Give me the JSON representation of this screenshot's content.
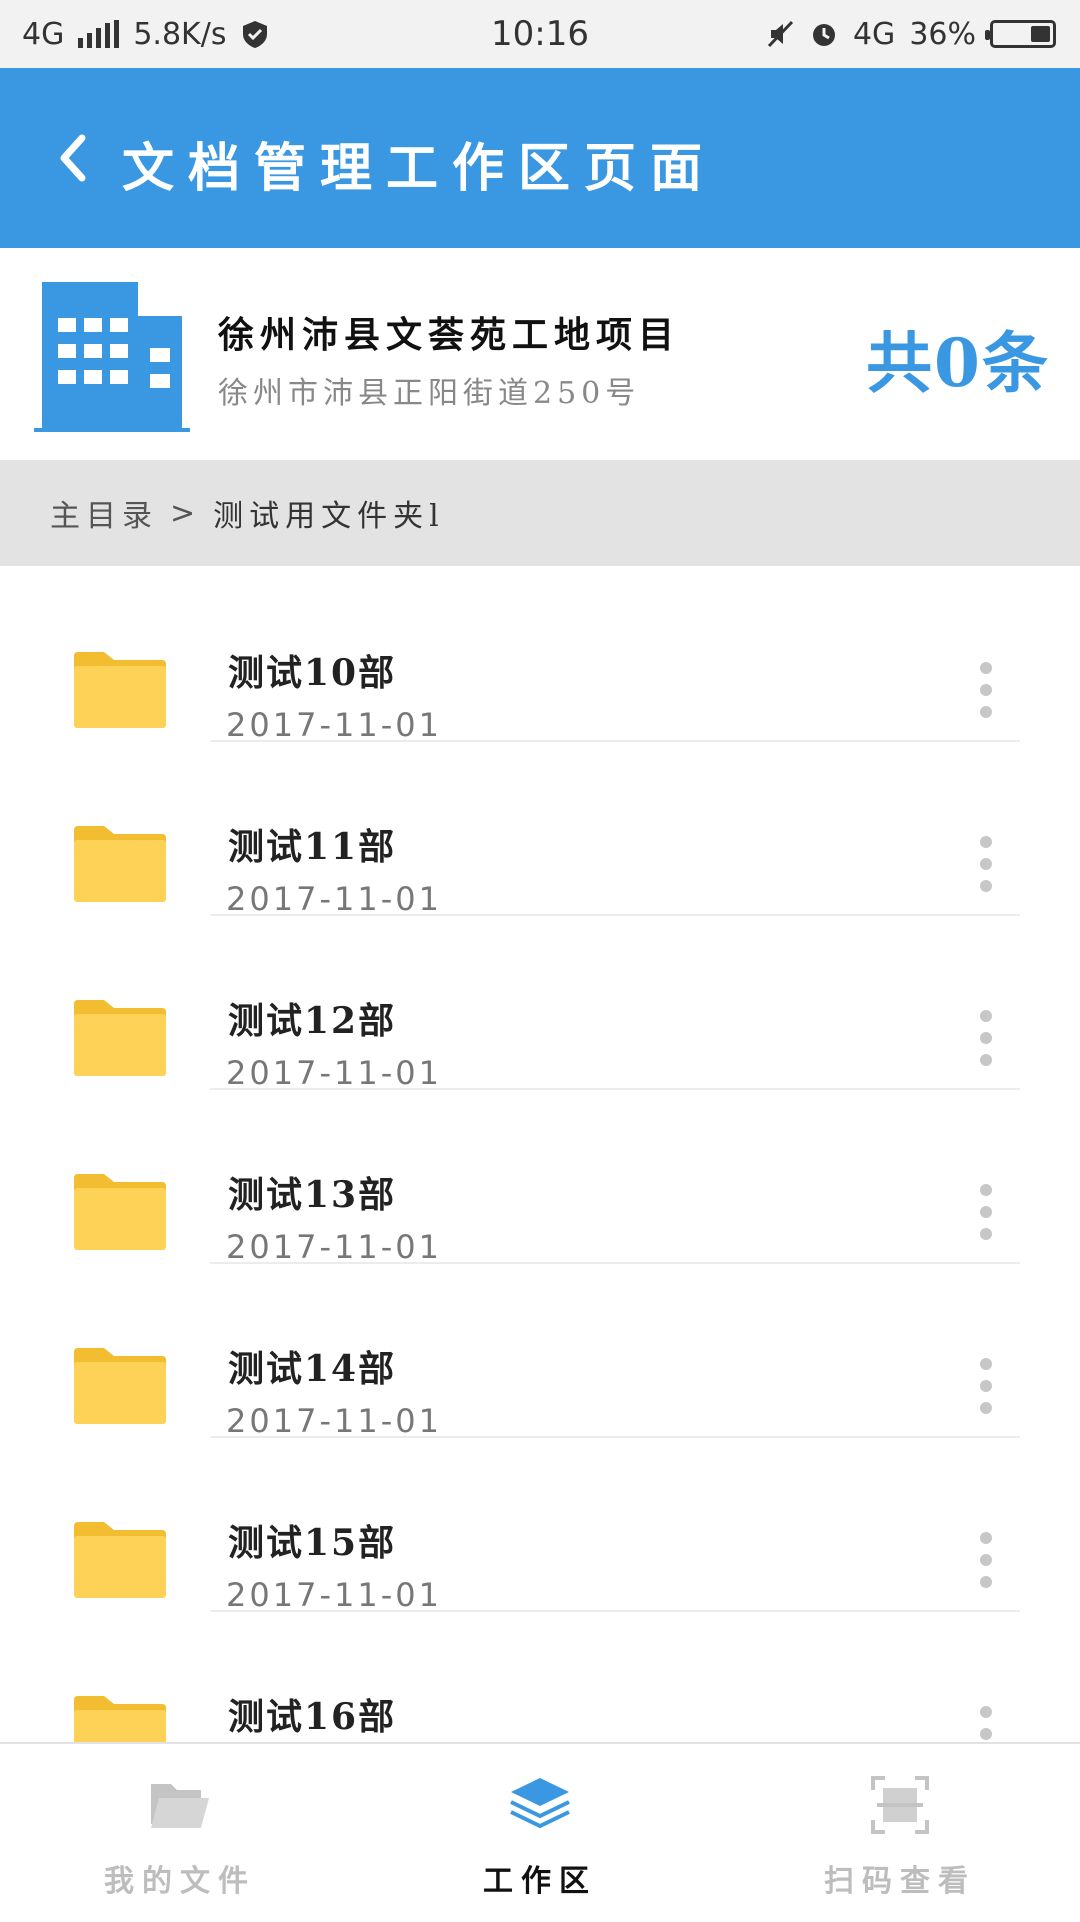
{
  "status_bar": {
    "network": "4G",
    "speed": "5.8K/s",
    "time": "10:16",
    "network_right": "4G",
    "battery": "36%",
    "battery_level": 0.36
  },
  "header": {
    "title": "文档管理工作区页面",
    "background": "#3a98e3"
  },
  "project": {
    "name": "徐州沛县文荟苑工地项目",
    "address": "徐州市沛县正阳街道250号",
    "count": "共0条",
    "accent": "#3a98e3"
  },
  "breadcrumb": {
    "home": "主目录",
    "separator": ">",
    "current": "测试用文件夹l"
  },
  "files": [
    {
      "name": "测试10部",
      "date": "2017-11-01"
    },
    {
      "name": "测试11部",
      "date": "2017-11-01"
    },
    {
      "name": "测试12部",
      "date": "2017-11-01"
    },
    {
      "name": "测试13部",
      "date": "2017-11-01"
    },
    {
      "name": "测试14部",
      "date": "2017-11-01"
    },
    {
      "name": "测试15部",
      "date": "2017-11-01"
    },
    {
      "name": "测试16部",
      "date": ""
    }
  ],
  "bottom_nav": {
    "items": [
      {
        "label": "我的文件",
        "icon": "folder-open-icon",
        "active": false
      },
      {
        "label": "工作区",
        "icon": "layers-icon",
        "active": true
      },
      {
        "label": "扫码查看",
        "icon": "scan-icon",
        "active": false
      }
    ]
  }
}
